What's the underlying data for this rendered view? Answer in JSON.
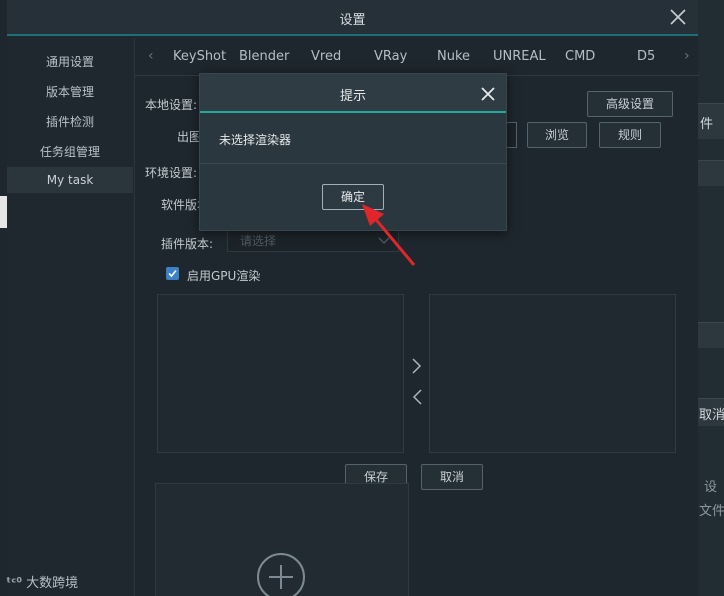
{
  "window": {
    "title": "设置"
  },
  "sidebar": {
    "items": [
      {
        "label": "通用设置"
      },
      {
        "label": "版本管理"
      },
      {
        "label": "插件检测"
      },
      {
        "label": "任务组管理"
      },
      {
        "label": "My task"
      }
    ]
  },
  "tabs": [
    "KeyShot",
    "Blender",
    "Vred",
    "VRay",
    "Nuke",
    "UNREAL",
    "CMD",
    "D5"
  ],
  "content": {
    "local_settings_label": "本地设置:",
    "output_label": "出图",
    "advanced_button": "高级设置",
    "browse_button": "浏览",
    "rules_button": "规则",
    "env_settings_label": "环境设置:",
    "software_version_label": "软件版本",
    "plugin_version_label": "插件版本:",
    "plugin_version_placeholder": "请选择",
    "gpu_render_label": "启用GPU渲染",
    "gpu_render_checked": true,
    "save_button": "保存",
    "cancel_button": "取消"
  },
  "dialog": {
    "title": "提示",
    "message": "未选择渲染器",
    "ok_button": "确定"
  },
  "background": {
    "right_texts": [
      "件",
      "取消",
      "设",
      "文件"
    ]
  },
  "watermark": {
    "mark": "ᵗᶜ⁰",
    "text": "大数跨境"
  },
  "colors": {
    "accent": "#23a89a",
    "checkbox": "#3a82c4",
    "annotation_arrow": "#e0262a"
  }
}
